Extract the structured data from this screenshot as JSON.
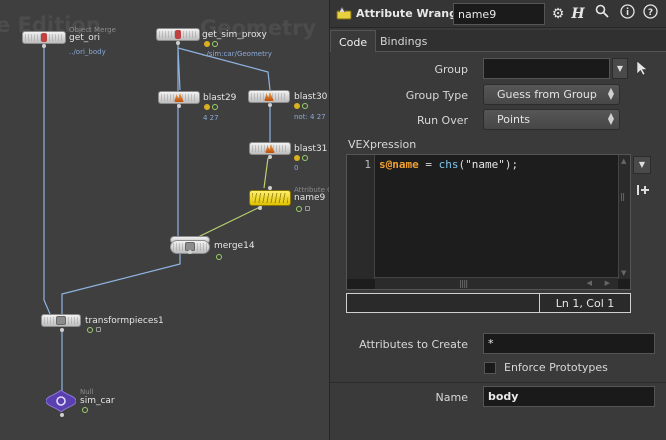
{
  "network": {
    "watermark_left": "e Edition",
    "watermark_right": "Geometry",
    "nodes": {
      "get_ori": {
        "type": "Object Merge",
        "name": "get_ori",
        "sub": "../ori_body"
      },
      "get_sim_proxy": {
        "name": "get_sim_proxy",
        "sub": "../sim:car/Geometry"
      },
      "blast29": {
        "name": "blast29",
        "sub": "4 27"
      },
      "blast30": {
        "name": "blast30",
        "sub": "not: 4 27"
      },
      "blast31": {
        "name": "blast31",
        "sub": "0"
      },
      "name9": {
        "type": "Attribute C",
        "name": "name9"
      },
      "merge14": {
        "name": "merge14"
      },
      "transformpieces1": {
        "name": "transformpieces1"
      },
      "sim_car": {
        "type": "Null",
        "name": "sim_car"
      }
    }
  },
  "toolbar": {
    "title": "Attribute Wrangle",
    "node_name": "name9",
    "icons": [
      "gear-icon",
      "help-h-icon",
      "magnifier-icon",
      "info-icon",
      "question-icon"
    ]
  },
  "tabs": [
    {
      "label": "Code",
      "active": true
    },
    {
      "label": "Bindings",
      "active": false
    }
  ],
  "params": {
    "group_label": "Group",
    "group_value": "",
    "group_type_label": "Group Type",
    "group_type_value": "Guess from Group",
    "run_over_label": "Run Over",
    "run_over_value": "Points",
    "vex_label": "VEXpression",
    "line_number": "1",
    "code": {
      "attr": "s@name",
      "op": " = ",
      "fn": "chs",
      "open": "(",
      "str": "\"name\"",
      "close": ");"
    },
    "cursor_position": "Ln 1, Col 1",
    "attributes_to_create_label": "Attributes to Create",
    "attributes_to_create_value": "*",
    "enforce_prototypes_label": "Enforce Prototypes",
    "enforce_prototypes_checked": false,
    "name_label": "Name",
    "name_value": "body"
  },
  "colors": {
    "selected_node": "#f2d800",
    "accent_attr": "#f0a030",
    "function_token": "#7ec8ee"
  }
}
